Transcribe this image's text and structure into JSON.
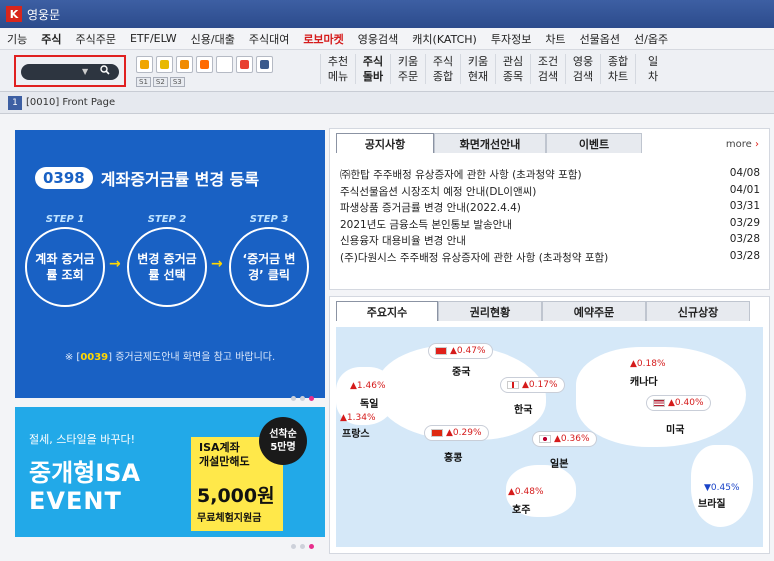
{
  "window": {
    "title": "영웅문",
    "logo_char": "K"
  },
  "menu": [
    {
      "label": "기능",
      "style": ""
    },
    {
      "label": "주식",
      "style": "bold"
    },
    {
      "label": "주식주문",
      "style": ""
    },
    {
      "label": "ETF/ELW",
      "style": ""
    },
    {
      "label": "신용/대출",
      "style": ""
    },
    {
      "label": "주식대여",
      "style": ""
    },
    {
      "label": "로보마켓",
      "style": "red"
    },
    {
      "label": "영웅검색",
      "style": ""
    },
    {
      "label": "캐치(KATCH)",
      "style": ""
    },
    {
      "label": "투자정보",
      "style": ""
    },
    {
      "label": "차트",
      "style": ""
    },
    {
      "label": "선물옵션",
      "style": ""
    },
    {
      "label": "선/옵주",
      "style": ""
    }
  ],
  "toolbar": {
    "search_arrow": "▼",
    "search_icon": "magnifier-icon",
    "icon_names": [
      "save-icon",
      "brush-icon",
      "lock-icon",
      "camera-icon",
      "screen-icon",
      "monitor-icon",
      "gear-icon"
    ],
    "icon_colors": [
      "#f0a500",
      "#e8b800",
      "#f08a00",
      "#ff6a00",
      "#ffffff",
      "#e84030",
      "#3a5a8c"
    ],
    "slots": [
      "S1",
      "S2",
      "S3"
    ],
    "buttons": [
      {
        "line1": "추천",
        "line2": "메뉴",
        "bold": false
      },
      {
        "line1": "주식",
        "line2": "돌바",
        "bold": true
      },
      {
        "line1": "키움",
        "line2": "주문",
        "bold": false
      },
      {
        "line1": "주식",
        "line2": "종합",
        "bold": false
      },
      {
        "line1": "키움",
        "line2": "현재",
        "bold": false
      },
      {
        "line1": "관심",
        "line2": "종목",
        "bold": false
      },
      {
        "line1": "조건",
        "line2": "검색",
        "bold": false
      },
      {
        "line1": "영웅",
        "line2": "검색",
        "bold": false
      },
      {
        "line1": "종합",
        "line2": "차트",
        "bold": false
      },
      {
        "line1": "일",
        "line2": "차",
        "bold": false
      }
    ]
  },
  "subbar": {
    "num": "1",
    "label": "[0010] Front Page"
  },
  "banner1": {
    "code": "0398",
    "title": "계좌증거금률 변경 등록",
    "steps": [
      {
        "label": "STEP 1",
        "text": "계좌 증거금률 조회"
      },
      {
        "label": "STEP 2",
        "text": "변경 증거금률 선택"
      },
      {
        "label": "STEP 3",
        "text": "‘증거금 변경’ 클릭"
      }
    ],
    "arrow": "→",
    "note_prefix": "※ [",
    "note_code": "0039",
    "note_suffix": "] 증거금제도안내 화면을 참고 바랍니다."
  },
  "banner2": {
    "line1": "절세, 스타일을 바꾸다!",
    "line2": "중개형ISA",
    "line3": "EVENT",
    "card_line1": "ISA계좌",
    "card_line2": "개설만해도",
    "card_amount": "5,000원",
    "card_sub": "무료체험지원금",
    "badge_line1": "선착순",
    "badge_line2": "5만명"
  },
  "notice_panel": {
    "tabs": [
      "공지사항",
      "화면개선안내",
      "이벤트"
    ],
    "active_tab": 0,
    "more": "more",
    "more_arrow": "›",
    "items": [
      {
        "title": "㈜한탑 주주배정 유상증자에 관한 사항 (초과청약 포함)",
        "date": "04/08"
      },
      {
        "title": "주식선물옵션 시장조치 예정 안내(DL이앤씨)",
        "date": "04/01"
      },
      {
        "title": "파생상품 증거금률 변경 안내(2022.4.4)",
        "date": "03/31"
      },
      {
        "title": "2021년도 금융소득 본인통보 발송안내",
        "date": "03/29"
      },
      {
        "title": "신용융자 대용비율 변경 안내",
        "date": "03/28"
      },
      {
        "title": "(주)다원시스 주주배정 유상증자에 관한 사항 (초과청약 포함)",
        "date": "03/28"
      }
    ]
  },
  "index_panel": {
    "tabs": [
      "주요지수",
      "권리현황",
      "예약주문",
      "신규상장"
    ],
    "active_tab": 0,
    "markets": [
      {
        "name": "중국",
        "value": "▲0.47%",
        "dir": "up",
        "flag": "china"
      },
      {
        "name": "캐나다",
        "value": "▲0.18%",
        "dir": "up",
        "flag": ""
      },
      {
        "name": "독일",
        "value": "▲1.46%",
        "dir": "up",
        "flag": ""
      },
      {
        "name": "프랑스",
        "value": "▲1.34%",
        "dir": "up",
        "flag": ""
      },
      {
        "name": "한국",
        "value": "▲0.17%",
        "dir": "up",
        "flag": "korea"
      },
      {
        "name": "미국",
        "value": "▲0.40%",
        "dir": "up",
        "flag": "usa"
      },
      {
        "name": "홍콩",
        "value": "▲0.29%",
        "dir": "up",
        "flag": "hongkong"
      },
      {
        "name": "일본",
        "value": "▲0.36%",
        "dir": "up",
        "flag": "japan"
      },
      {
        "name": "호주",
        "value": "▲0.48%",
        "dir": "up",
        "flag": ""
      },
      {
        "name": "브라질",
        "value": "▼0.45%",
        "dir": "down",
        "flag": ""
      }
    ]
  }
}
